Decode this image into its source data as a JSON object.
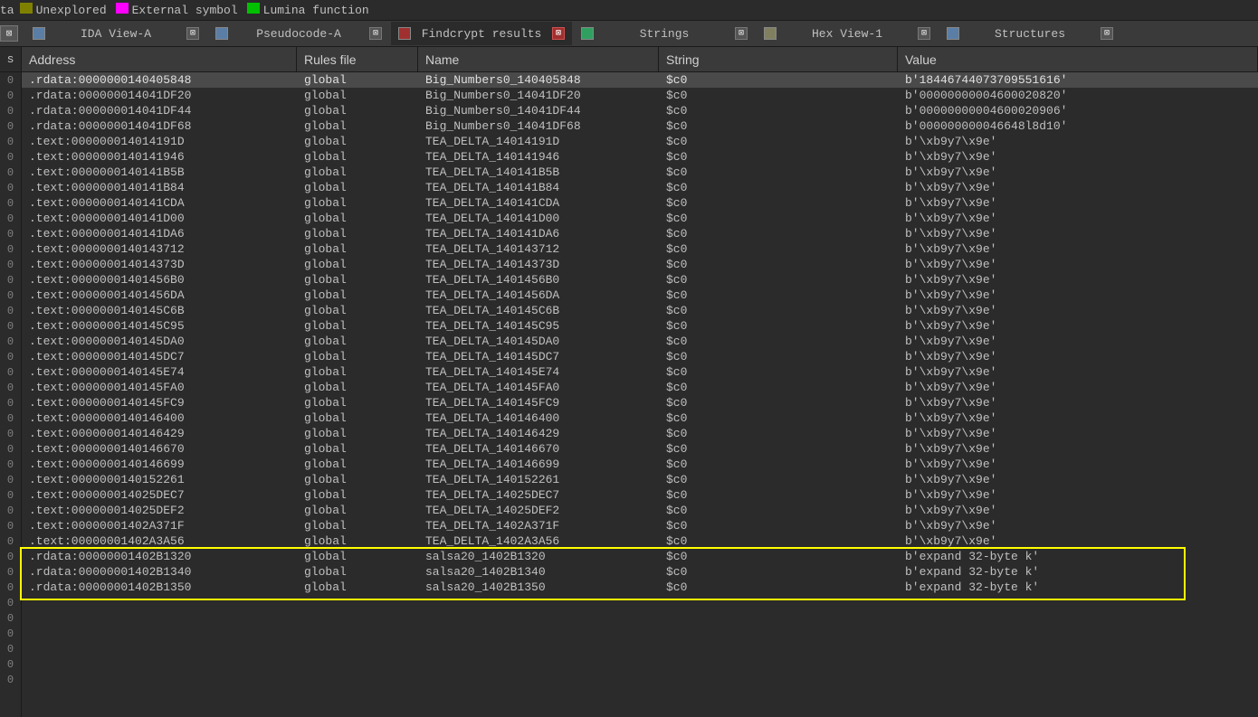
{
  "legend": {
    "cut": "ta",
    "items": [
      {
        "color": "olive",
        "label": "Unexplored"
      },
      {
        "color": "magenta",
        "label": "External symbol"
      },
      {
        "color": "green",
        "label": "Lumina function"
      }
    ]
  },
  "tabs": [
    {
      "icon": "blue",
      "label": "IDA View-A",
      "active": false
    },
    {
      "icon": "blue",
      "label": "Pseudocode-A",
      "active": false
    },
    {
      "icon": "red",
      "label": "Findcrypt results",
      "active": true
    },
    {
      "icon": "green",
      "label": "Strings",
      "active": false
    },
    {
      "icon": "olive",
      "label": "Hex View-1",
      "active": false
    },
    {
      "icon": "blue",
      "label": "Structures",
      "active": false
    }
  ],
  "columns": {
    "gutter": "s",
    "address": "Address",
    "rules": "Rules file",
    "name": "Name",
    "string": "String",
    "value": "Value"
  },
  "gutter_char": "0",
  "rows": [
    {
      "address": ".rdata:0000000140405848",
      "rules": "global",
      "name": "Big_Numbers0_140405848",
      "string": "$c0",
      "value": "b'18446744073709551616'",
      "sel": true
    },
    {
      "address": ".rdata:000000014041DF20",
      "rules": "global",
      "name": "Big_Numbers0_14041DF20",
      "string": "$c0",
      "value": "b'00000000004600020820'"
    },
    {
      "address": ".rdata:000000014041DF44",
      "rules": "global",
      "name": "Big_Numbers0_14041DF44",
      "string": "$c0",
      "value": "b'00000000004600020906'"
    },
    {
      "address": ".rdata:000000014041DF68",
      "rules": "global",
      "name": "Big_Numbers0_14041DF68",
      "string": "$c0",
      "value": "b'000000000046648l8d10'"
    },
    {
      "address": ".text:000000014014191D",
      "rules": "global",
      "name": "TEA_DELTA_14014191D",
      "string": "$c0",
      "value": "b'\\xb9y7\\x9e'"
    },
    {
      "address": ".text:0000000140141946",
      "rules": "global",
      "name": "TEA_DELTA_140141946",
      "string": "$c0",
      "value": "b'\\xb9y7\\x9e'"
    },
    {
      "address": ".text:0000000140141B5B",
      "rules": "global",
      "name": "TEA_DELTA_140141B5B",
      "string": "$c0",
      "value": "b'\\xb9y7\\x9e'"
    },
    {
      "address": ".text:0000000140141B84",
      "rules": "global",
      "name": "TEA_DELTA_140141B84",
      "string": "$c0",
      "value": "b'\\xb9y7\\x9e'"
    },
    {
      "address": ".text:0000000140141CDA",
      "rules": "global",
      "name": "TEA_DELTA_140141CDA",
      "string": "$c0",
      "value": "b'\\xb9y7\\x9e'"
    },
    {
      "address": ".text:0000000140141D00",
      "rules": "global",
      "name": "TEA_DELTA_140141D00",
      "string": "$c0",
      "value": "b'\\xb9y7\\x9e'"
    },
    {
      "address": ".text:0000000140141DA6",
      "rules": "global",
      "name": "TEA_DELTA_140141DA6",
      "string": "$c0",
      "value": "b'\\xb9y7\\x9e'"
    },
    {
      "address": ".text:0000000140143712",
      "rules": "global",
      "name": "TEA_DELTA_140143712",
      "string": "$c0",
      "value": "b'\\xb9y7\\x9e'"
    },
    {
      "address": ".text:000000014014373D",
      "rules": "global",
      "name": "TEA_DELTA_14014373D",
      "string": "$c0",
      "value": "b'\\xb9y7\\x9e'"
    },
    {
      "address": ".text:00000001401456B0",
      "rules": "global",
      "name": "TEA_DELTA_1401456B0",
      "string": "$c0",
      "value": "b'\\xb9y7\\x9e'"
    },
    {
      "address": ".text:00000001401456DA",
      "rules": "global",
      "name": "TEA_DELTA_1401456DA",
      "string": "$c0",
      "value": "b'\\xb9y7\\x9e'"
    },
    {
      "address": ".text:0000000140145C6B",
      "rules": "global",
      "name": "TEA_DELTA_140145C6B",
      "string": "$c0",
      "value": "b'\\xb9y7\\x9e'"
    },
    {
      "address": ".text:0000000140145C95",
      "rules": "global",
      "name": "TEA_DELTA_140145C95",
      "string": "$c0",
      "value": "b'\\xb9y7\\x9e'"
    },
    {
      "address": ".text:0000000140145DA0",
      "rules": "global",
      "name": "TEA_DELTA_140145DA0",
      "string": "$c0",
      "value": "b'\\xb9y7\\x9e'"
    },
    {
      "address": ".text:0000000140145DC7",
      "rules": "global",
      "name": "TEA_DELTA_140145DC7",
      "string": "$c0",
      "value": "b'\\xb9y7\\x9e'"
    },
    {
      "address": ".text:0000000140145E74",
      "rules": "global",
      "name": "TEA_DELTA_140145E74",
      "string": "$c0",
      "value": "b'\\xb9y7\\x9e'"
    },
    {
      "address": ".text:0000000140145FA0",
      "rules": "global",
      "name": "TEA_DELTA_140145FA0",
      "string": "$c0",
      "value": "b'\\xb9y7\\x9e'"
    },
    {
      "address": ".text:0000000140145FC9",
      "rules": "global",
      "name": "TEA_DELTA_140145FC9",
      "string": "$c0",
      "value": "b'\\xb9y7\\x9e'"
    },
    {
      "address": ".text:0000000140146400",
      "rules": "global",
      "name": "TEA_DELTA_140146400",
      "string": "$c0",
      "value": "b'\\xb9y7\\x9e'"
    },
    {
      "address": ".text:0000000140146429",
      "rules": "global",
      "name": "TEA_DELTA_140146429",
      "string": "$c0",
      "value": "b'\\xb9y7\\x9e'"
    },
    {
      "address": ".text:0000000140146670",
      "rules": "global",
      "name": "TEA_DELTA_140146670",
      "string": "$c0",
      "value": "b'\\xb9y7\\x9e'"
    },
    {
      "address": ".text:0000000140146699",
      "rules": "global",
      "name": "TEA_DELTA_140146699",
      "string": "$c0",
      "value": "b'\\xb9y7\\x9e'"
    },
    {
      "address": ".text:0000000140152261",
      "rules": "global",
      "name": "TEA_DELTA_140152261",
      "string": "$c0",
      "value": "b'\\xb9y7\\x9e'"
    },
    {
      "address": ".text:000000014025DEC7",
      "rules": "global",
      "name": "TEA_DELTA_14025DEC7",
      "string": "$c0",
      "value": "b'\\xb9y7\\x9e'"
    },
    {
      "address": ".text:000000014025DEF2",
      "rules": "global",
      "name": "TEA_DELTA_14025DEF2",
      "string": "$c0",
      "value": "b'\\xb9y7\\x9e'"
    },
    {
      "address": ".text:00000001402A371F",
      "rules": "global",
      "name": "TEA_DELTA_1402A371F",
      "string": "$c0",
      "value": "b'\\xb9y7\\x9e'"
    },
    {
      "address": ".text:00000001402A3A56",
      "rules": "global",
      "name": "TEA_DELTA_1402A3A56",
      "string": "$c0",
      "value": "b'\\xb9y7\\x9e'"
    },
    {
      "address": ".rdata:00000001402B1320",
      "rules": "global",
      "name": "salsa20_1402B1320",
      "string": "$c0",
      "value": "b'expand 32-byte k'",
      "hl": true
    },
    {
      "address": ".rdata:00000001402B1340",
      "rules": "global",
      "name": "salsa20_1402B1340",
      "string": "$c0",
      "value": "b'expand 32-byte k'",
      "hl": true
    },
    {
      "address": ".rdata:00000001402B1350",
      "rules": "global",
      "name": "salsa20_1402B1350",
      "string": "$c0",
      "value": "b'expand 32-byte k'",
      "hl": true
    }
  ],
  "blank_gutter_rows": 6,
  "close_glyph": "⊠"
}
